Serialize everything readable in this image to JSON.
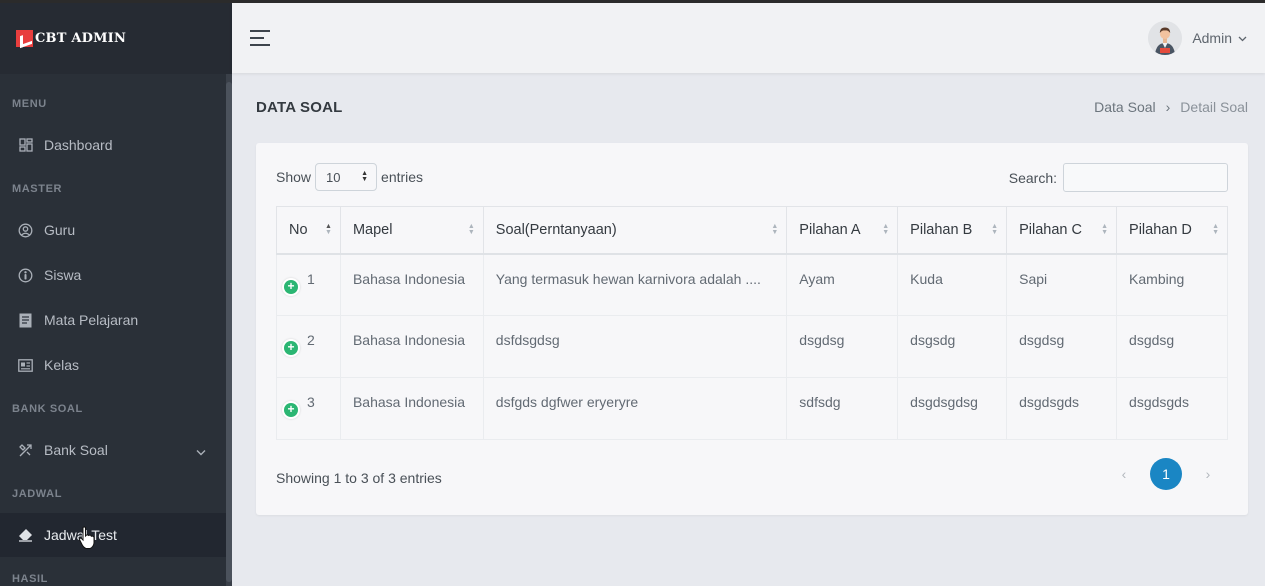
{
  "app": {
    "brand": "CBT ADMIN"
  },
  "sidebar": {
    "sections": [
      {
        "title": "MENU"
      },
      {
        "title": "MASTER"
      },
      {
        "title": "BANK SOAL"
      },
      {
        "title": "JADWAL"
      },
      {
        "title": "HASIL"
      }
    ],
    "items": [
      {
        "label": "Dashboard",
        "icon": "dashboard-icon"
      },
      {
        "label": "Guru",
        "icon": "user-circle-icon"
      },
      {
        "label": "Siswa",
        "icon": "person-icon"
      },
      {
        "label": "Mata Pelajaran",
        "icon": "book-icon"
      },
      {
        "label": "Kelas",
        "icon": "class-icon"
      },
      {
        "label": "Bank Soal",
        "icon": "tools-icon"
      },
      {
        "label": "Jadwal Test",
        "icon": "eraser-icon",
        "active": true
      }
    ]
  },
  "header": {
    "user": "Admin"
  },
  "page": {
    "title": "DATA SOAL",
    "breadcrumb": [
      "Data Soal",
      "Detail Soal"
    ],
    "breadcrumb_sep": "›"
  },
  "table_controls": {
    "show_label": "Show",
    "entries_value": "10",
    "entries_label": "entries",
    "search_label": "Search:",
    "search_value": ""
  },
  "table": {
    "columns": [
      "No",
      "Mapel",
      "Soal(Perntanyaan)",
      "Pilahan A",
      "Pilahan B",
      "Pilahan C",
      "Pilahan D"
    ],
    "rows": [
      [
        "1",
        "Bahasa Indonesia",
        "Yang termasuk hewan karnivora adalah ....",
        "Ayam",
        "Kuda",
        "Sapi",
        "Kambing"
      ],
      [
        "2",
        "Bahasa Indonesia",
        "dsfdsgdsg",
        "dsgdsg",
        "dsgsdg",
        "dsgdsg",
        "dsgdsg"
      ],
      [
        "3",
        "Bahasa Indonesia",
        "dsfgds dgfwer eryeryre",
        "sdfsdg",
        "dsgdsgdsg",
        "dsgdsgds",
        "dsgdsgds"
      ]
    ]
  },
  "footer": {
    "info": "Showing 1 to 3 of 3 entries",
    "prev": "‹",
    "page": "1",
    "next": "›"
  },
  "colors": {
    "sidebar_bg": "#2a3038",
    "accent": "#1a86c4",
    "expand_button": "#2bb673",
    "brand_logo": "#e83e3e"
  }
}
